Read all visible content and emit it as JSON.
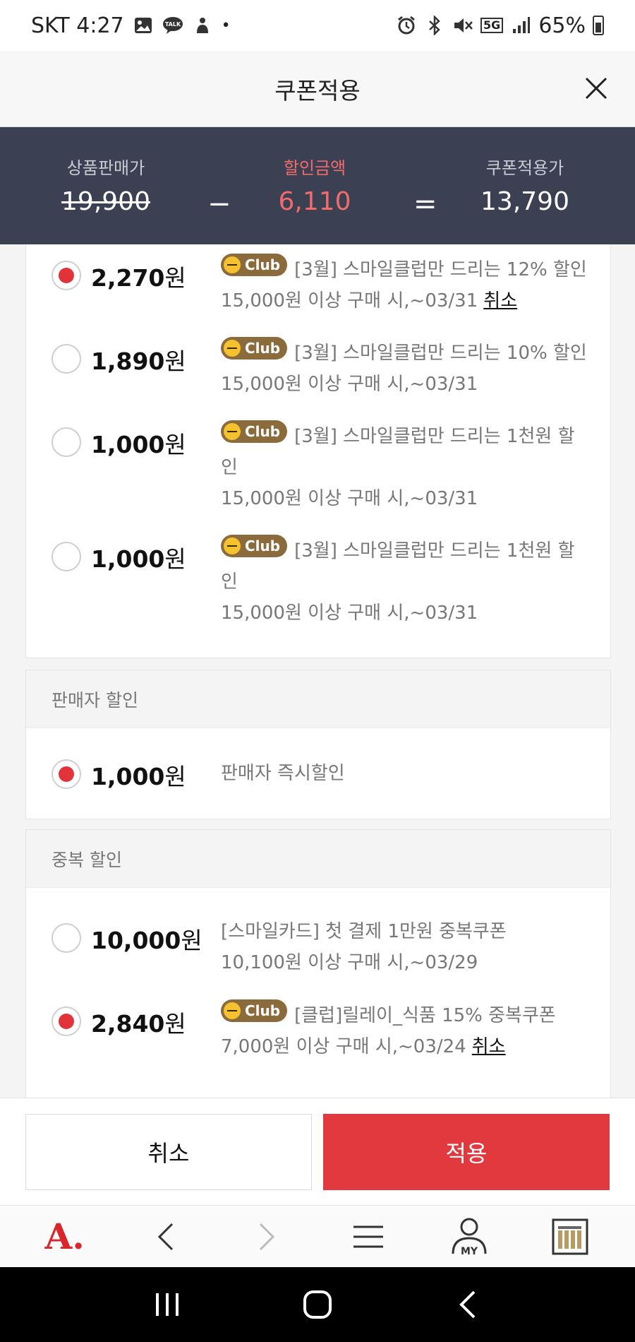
{
  "status_bar": {
    "carrier_time": "SKT 4:27",
    "talk_label": "TALK",
    "network": "5G",
    "battery": "65%"
  },
  "header": {
    "title": "쿠폰적용"
  },
  "summary": {
    "sale_price_label": "상품판매가",
    "sale_price": "19,900",
    "minus": "−",
    "discount_label": "할인금액",
    "discount": "6,110",
    "equals": "=",
    "final_label": "쿠폰적용가",
    "final_price": "13,790"
  },
  "club_badge": "Club",
  "coupon_list": [
    {
      "amount": "2,270",
      "won": "원",
      "selected": true,
      "title": "[3월] 스마일클럽만 드리는 12% 할인",
      "condition": "15,000원 이상 구매 시,~03/31",
      "cancel": "취소"
    },
    {
      "amount": "1,890",
      "won": "원",
      "selected": false,
      "title": "[3월] 스마일클럽만 드리는 10% 할인",
      "condition": "15,000원 이상 구매 시,~03/31"
    },
    {
      "amount": "1,000",
      "won": "원",
      "selected": false,
      "title": "[3월] 스마일클럽만 드리는 1천원 할인",
      "condition": "15,000원 이상 구매 시,~03/31"
    },
    {
      "amount": "1,000",
      "won": "원",
      "selected": false,
      "title": "[3월] 스마일클럽만 드리는 1천원 할인",
      "condition": "15,000원 이상 구매 시,~03/31"
    }
  ],
  "seller_section": {
    "title": "판매자 할인",
    "amount": "1,000",
    "won": "원",
    "desc": "판매자 즉시할인",
    "selected": true
  },
  "dup_section": {
    "title": "중복 할인",
    "items": [
      {
        "amount": "10,000",
        "won": "원",
        "selected": false,
        "title": "[스마일카드] 첫 결제 1만원 중복쿠폰",
        "condition": "10,100원 이상 구매 시,~03/29"
      },
      {
        "amount": "2,840",
        "won": "원",
        "selected": true,
        "title": "[클럽]릴레이_식품 15% 중복쿠폰",
        "condition": "7,000원 이상 구매 시,~03/24",
        "cancel": "취소"
      }
    ]
  },
  "buttons": {
    "cancel": "취소",
    "apply": "적용"
  },
  "nav": {
    "logo": "A.",
    "my": "MY"
  },
  "colors": {
    "accent": "#e2393f",
    "summary_bg": "#3b4152",
    "club_badge": "#8b6b3c"
  }
}
